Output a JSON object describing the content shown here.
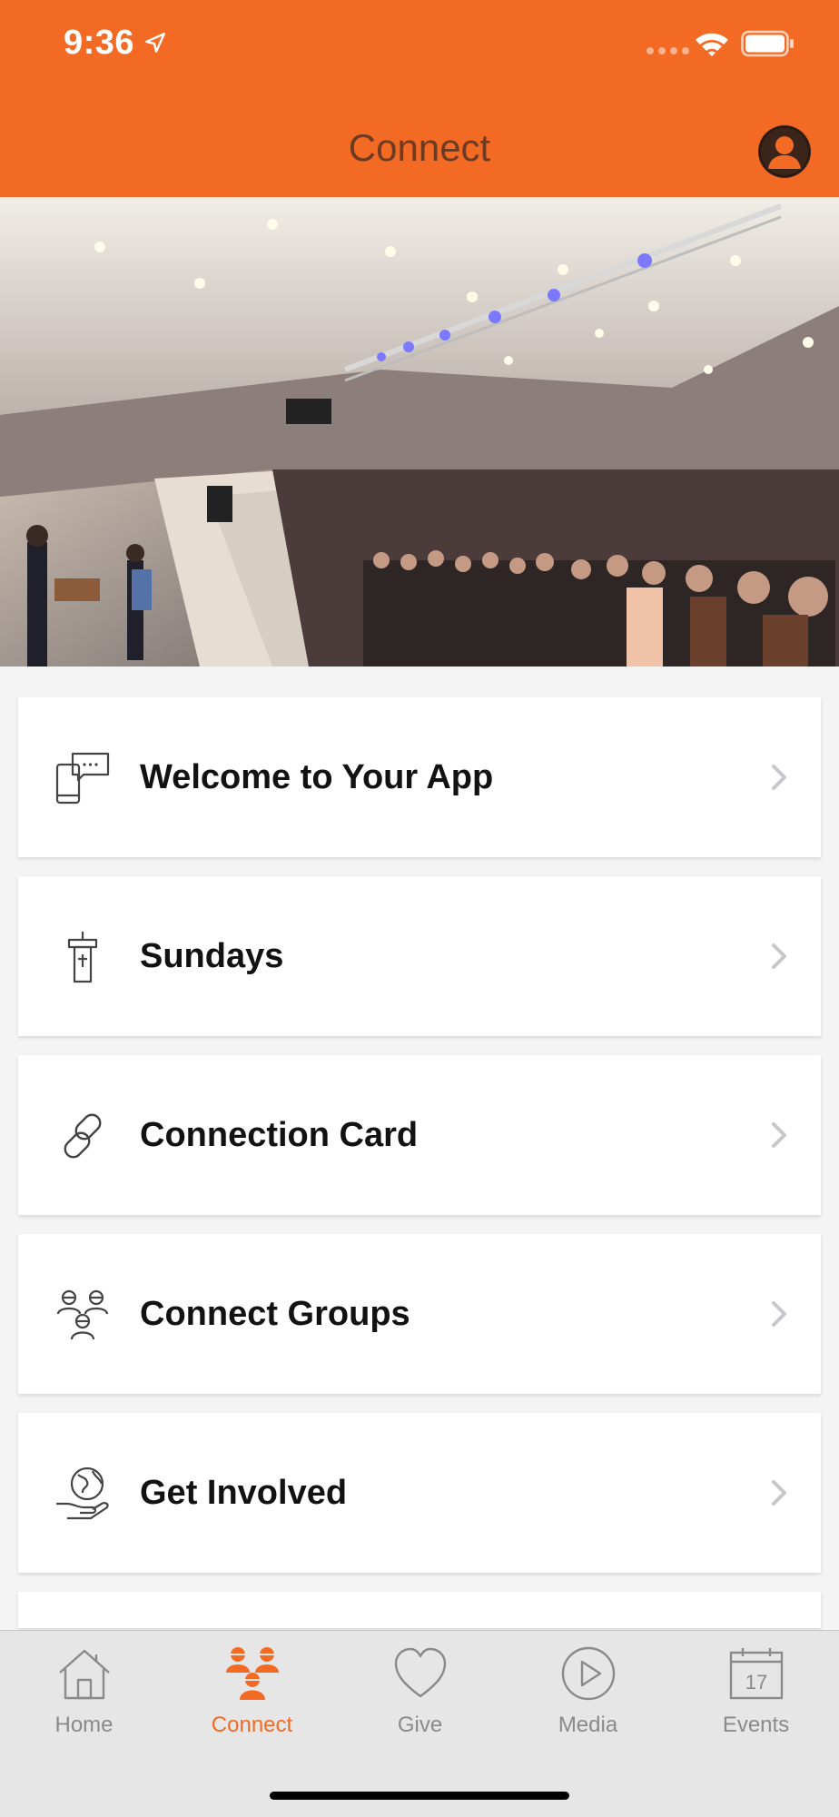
{
  "status_bar": {
    "time": "9:36"
  },
  "header": {
    "title": "Connect"
  },
  "hero": {
    "description_icon": "church-worship-photo"
  },
  "menu": [
    {
      "label": "Welcome to Your App",
      "icon": "mobile-chat-icon"
    },
    {
      "label": "Sundays",
      "icon": "pulpit-icon"
    },
    {
      "label": "Connection Card",
      "icon": "link-icon"
    },
    {
      "label": "Connect Groups",
      "icon": "group-icon"
    },
    {
      "label": "Get Involved",
      "icon": "globe-hand-icon"
    }
  ],
  "tabs": [
    {
      "label": "Home",
      "icon": "home-icon",
      "active": false
    },
    {
      "label": "Connect",
      "icon": "people-icon",
      "active": true
    },
    {
      "label": "Give",
      "icon": "heart-icon",
      "active": false
    },
    {
      "label": "Media",
      "icon": "play-icon",
      "active": false
    },
    {
      "label": "Events",
      "icon": "calendar-icon",
      "active": false,
      "date_number": "17"
    }
  ],
  "colors": {
    "accent": "#f26a24",
    "title": "#6d3a22",
    "tab_inactive": "#8a8a8a"
  }
}
